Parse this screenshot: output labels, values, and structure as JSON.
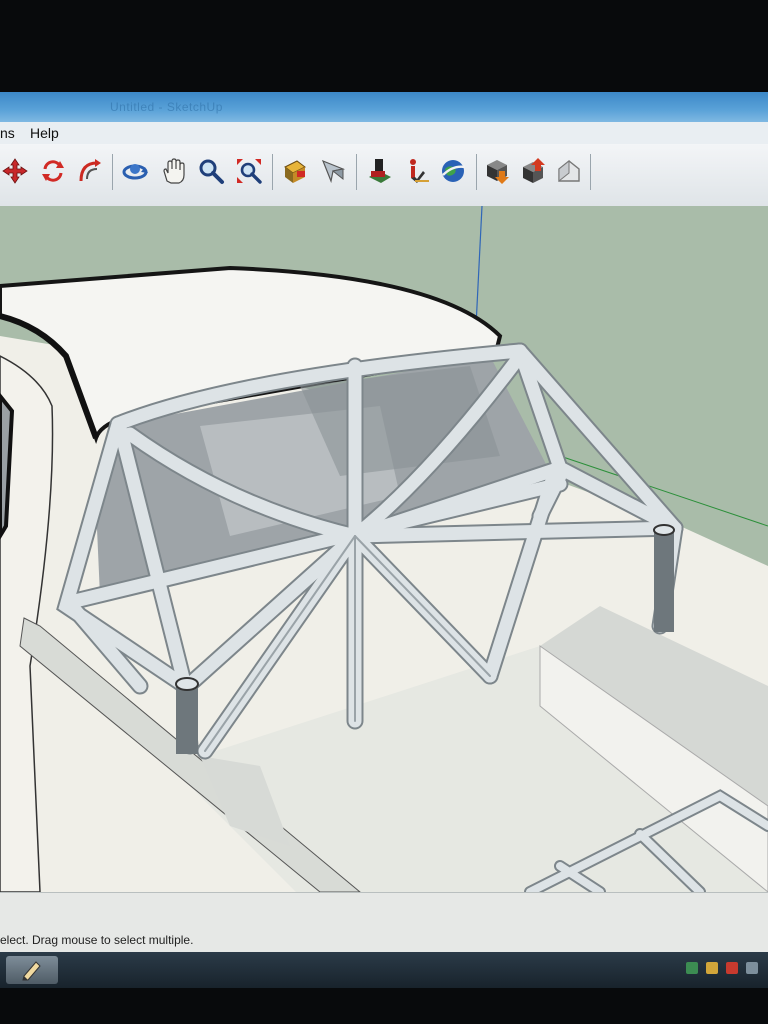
{
  "window": {
    "title": "Untitled - SketchUp"
  },
  "menu": {
    "items": [
      "ns",
      "Help"
    ]
  },
  "toolbar": {
    "tools": [
      {
        "name": "move-icon",
        "label": "Move"
      },
      {
        "name": "rotate-icon",
        "label": "Rotate"
      },
      {
        "name": "follow-me-icon",
        "label": "Follow Me"
      },
      {
        "name": "orbit-icon",
        "label": "Orbit"
      },
      {
        "name": "pan-icon",
        "label": "Pan"
      },
      {
        "name": "zoom-icon",
        "label": "Zoom"
      },
      {
        "name": "zoom-extents-icon",
        "label": "Zoom Extents"
      },
      {
        "name": "section-plane-icon",
        "label": "Section Plane"
      },
      {
        "name": "position-camera-icon",
        "label": "Position Camera"
      },
      {
        "name": "walk-icon",
        "label": "Walk"
      },
      {
        "name": "look-around-icon",
        "label": "Look Around"
      },
      {
        "name": "google-earth-icon",
        "label": "Google Earth"
      },
      {
        "name": "get-models-icon",
        "label": "Get Models"
      },
      {
        "name": "share-model-icon",
        "label": "Share Model"
      },
      {
        "name": "components-icon",
        "label": "Components"
      }
    ]
  },
  "status": {
    "text": "elect. Drag mouse to select multiple."
  },
  "colors": {
    "sky": "#a9bca9",
    "ground": "#f0efe8",
    "tube": "#dfe5e8",
    "glass": "#9ea4a8",
    "toolbar_bg": "#e6eaed",
    "titlebar": "#4f97d2"
  }
}
